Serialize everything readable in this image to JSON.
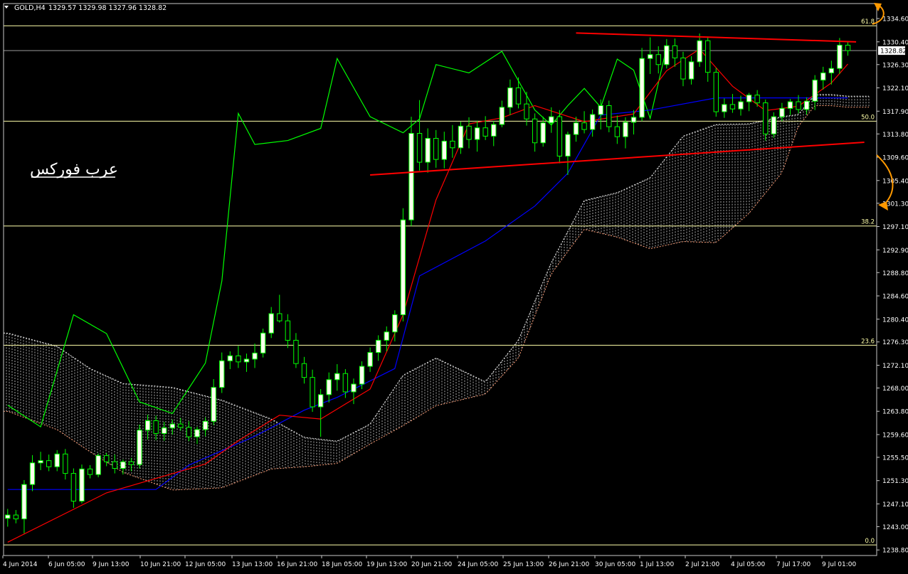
{
  "header": {
    "symbol_label": "GOLD,H4",
    "ohlc_text": "1329.57 1329.98 1327.96 1328.82"
  },
  "watermark": "عرب فوركس",
  "colors": {
    "background": "#000000",
    "axis": "#c8c8c8",
    "text": "#ffffff",
    "bull_candle": "#ffffee",
    "bear_candle": "#000000",
    "candle_line": "#00ff00",
    "tenkan": "#ff0000",
    "kijun": "#0000ff",
    "chikou": "#00ff00",
    "senkou_a": "#ffffff",
    "senkou_b": "#ffa07a",
    "fib": "#ffffaa",
    "trendline": "#ff0000",
    "annotation": "#ff9900"
  },
  "chart_data": {
    "type": "candlestick",
    "symbol": "GOLD",
    "timeframe": "H4",
    "last_price": 1328.82,
    "price_label": "1328.82",
    "ylim": [
      1237.8,
      1337.3
    ],
    "y_ticks": [
      "1334.60",
      "1330.40",
      "1326.30",
      "1322.10",
      "1317.90",
      "1313.80",
      "1309.60",
      "1305.40",
      "1301.30",
      "1297.10",
      "1292.90",
      "1288.80",
      "1284.60",
      "1280.40",
      "1276.30",
      "1272.10",
      "1268.00",
      "1263.80",
      "1259.60",
      "1255.50",
      "1251.30",
      "1247.10",
      "1243.00",
      "1238.80"
    ],
    "x_ticks": [
      "4 Jun 2014",
      "6 Jun 05:00",
      "9 Jun 13:00",
      "10 Jun 21:00",
      "12 Jun 05:00",
      "13 Jun 13:00",
      "16 Jun 21:00",
      "18 Jun 05:00",
      "19 Jun 13:00",
      "20 Jun 21:00",
      "24 Jun 05:00",
      "25 Jun 13:00",
      "26 Jun 21:00",
      "30 Jun 05:00",
      "1 Jul 13:00",
      "2 Jul 21:00",
      "4 Jul 05:00",
      "7 Jul 17:00",
      "9 Jul 01:00"
    ],
    "fibonacci": [
      {
        "label": "61.8",
        "price": 1333.3
      },
      {
        "label": "50.0",
        "price": 1316.1
      },
      {
        "label": "38.2",
        "price": 1297.2
      },
      {
        "label": "23.6",
        "price": 1275.7
      },
      {
        "label": "0.0",
        "price": 1239.7
      }
    ],
    "candles": [
      [
        1244.5,
        1246.2,
        1243.0,
        1245.1
      ],
      [
        1245.1,
        1246.0,
        1243.6,
        1244.4
      ],
      [
        1244.4,
        1251.4,
        1241.8,
        1250.6
      ],
      [
        1250.6,
        1255.9,
        1249.4,
        1254.5
      ],
      [
        1254.5,
        1256.5,
        1253.2,
        1254.9
      ],
      [
        1254.9,
        1256.0,
        1253.0,
        1253.8
      ],
      [
        1253.8,
        1256.8,
        1253.0,
        1256.1
      ],
      [
        1256.1,
        1257.0,
        1251.5,
        1252.6
      ],
      [
        1252.6,
        1253.5,
        1246.4,
        1247.6
      ],
      [
        1247.6,
        1254.2,
        1247.2,
        1253.4
      ],
      [
        1253.4,
        1254.1,
        1251.7,
        1252.4
      ],
      [
        1252.4,
        1256.2,
        1251.9,
        1255.8
      ],
      [
        1255.8,
        1256.3,
        1253.9,
        1254.7
      ],
      [
        1254.7,
        1256.0,
        1252.6,
        1253.5
      ],
      [
        1253.5,
        1255.1,
        1252.4,
        1254.7
      ],
      [
        1254.7,
        1255.4,
        1253.0,
        1254.2
      ],
      [
        1254.2,
        1261.4,
        1253.5,
        1260.4
      ],
      [
        1260.4,
        1263.2,
        1258.7,
        1262.1
      ],
      [
        1262.1,
        1263.0,
        1258.6,
        1259.8
      ],
      [
        1259.8,
        1261.9,
        1258.5,
        1260.8
      ],
      [
        1260.8,
        1262.3,
        1259.6,
        1261.5
      ],
      [
        1261.5,
        1262.6,
        1260.3,
        1260.9
      ],
      [
        1260.9,
        1262.0,
        1258.4,
        1259.2
      ],
      [
        1259.2,
        1261.0,
        1257.9,
        1260.5
      ],
      [
        1260.5,
        1262.7,
        1259.3,
        1262.0
      ],
      [
        1262.0,
        1269.6,
        1261.3,
        1268.1
      ],
      [
        1268.1,
        1274.4,
        1267.1,
        1272.9
      ],
      [
        1272.9,
        1274.6,
        1271.4,
        1273.8
      ],
      [
        1273.8,
        1275.6,
        1271.6,
        1272.7
      ],
      [
        1272.7,
        1274.2,
        1270.9,
        1273.2
      ],
      [
        1273.2,
        1276.0,
        1271.6,
        1274.3
      ],
      [
        1274.3,
        1278.7,
        1273.5,
        1277.9
      ],
      [
        1277.9,
        1282.6,
        1277.0,
        1281.4
      ],
      [
        1281.4,
        1284.8,
        1279.8,
        1280.1
      ],
      [
        1280.1,
        1281.3,
        1275.2,
        1276.6
      ],
      [
        1276.6,
        1277.9,
        1271.6,
        1272.4
      ],
      [
        1272.4,
        1273.6,
        1268.8,
        1269.9
      ],
      [
        1269.9,
        1271.3,
        1263.7,
        1264.6
      ],
      [
        1264.6,
        1267.8,
        1259.2,
        1266.8
      ],
      [
        1266.8,
        1270.8,
        1265.4,
        1269.5
      ],
      [
        1269.5,
        1272.3,
        1267.5,
        1270.6
      ],
      [
        1270.6,
        1271.4,
        1266.2,
        1267.3
      ],
      [
        1267.3,
        1269.7,
        1265.1,
        1268.7
      ],
      [
        1268.7,
        1272.8,
        1267.8,
        1271.9
      ],
      [
        1271.9,
        1275.3,
        1270.9,
        1274.4
      ],
      [
        1274.4,
        1277.5,
        1272.9,
        1276.6
      ],
      [
        1276.6,
        1279.1,
        1274.6,
        1278.1
      ],
      [
        1278.1,
        1282.0,
        1276.4,
        1281.2
      ],
      [
        1281.2,
        1300.4,
        1280.0,
        1298.3
      ],
      [
        1298.3,
        1316.9,
        1297.2,
        1313.9
      ],
      [
        1313.9,
        1319.9,
        1307.2,
        1308.7
      ],
      [
        1308.7,
        1314.8,
        1306.8,
        1313.0
      ],
      [
        1313.0,
        1314.5,
        1307.7,
        1309.2
      ],
      [
        1309.2,
        1314.2,
        1307.6,
        1312.5
      ],
      [
        1312.5,
        1315.4,
        1309.5,
        1311.3
      ],
      [
        1311.3,
        1316.0,
        1310.2,
        1315.2
      ],
      [
        1315.2,
        1316.8,
        1311.2,
        1312.8
      ],
      [
        1312.8,
        1316.2,
        1310.6,
        1314.9
      ],
      [
        1314.9,
        1317.0,
        1312.7,
        1313.4
      ],
      [
        1313.4,
        1316.1,
        1311.6,
        1315.5
      ],
      [
        1315.5,
        1319.8,
        1315.0,
        1318.6
      ],
      [
        1318.6,
        1323.6,
        1317.2,
        1322.1
      ],
      [
        1322.1,
        1324.0,
        1318.4,
        1319.2
      ],
      [
        1319.2,
        1321.4,
        1315.3,
        1316.5
      ],
      [
        1316.5,
        1317.5,
        1310.6,
        1312.2
      ],
      [
        1312.2,
        1316.9,
        1311.5,
        1315.8
      ],
      [
        1315.8,
        1318.6,
        1314.0,
        1316.9
      ],
      [
        1316.9,
        1318.1,
        1308.5,
        1309.8
      ],
      [
        1309.8,
        1314.2,
        1306.4,
        1313.7
      ],
      [
        1313.7,
        1316.9,
        1312.4,
        1315.8
      ],
      [
        1315.8,
        1317.9,
        1313.9,
        1314.6
      ],
      [
        1314.6,
        1318.2,
        1313.3,
        1317.3
      ],
      [
        1317.3,
        1320.0,
        1314.6,
        1318.9
      ],
      [
        1318.9,
        1319.8,
        1314.1,
        1315.1
      ],
      [
        1315.1,
        1317.1,
        1312.0,
        1313.3
      ],
      [
        1313.3,
        1316.8,
        1311.2,
        1315.9
      ],
      [
        1315.9,
        1318.1,
        1313.7,
        1316.8
      ],
      [
        1316.8,
        1329.3,
        1316.1,
        1327.4
      ],
      [
        1327.4,
        1331.2,
        1324.6,
        1328.1
      ],
      [
        1328.1,
        1329.6,
        1324.7,
        1326.3
      ],
      [
        1326.3,
        1330.9,
        1325.6,
        1329.7
      ],
      [
        1329.7,
        1331.0,
        1325.9,
        1327.5
      ],
      [
        1327.5,
        1328.6,
        1322.4,
        1323.7
      ],
      [
        1323.7,
        1327.8,
        1322.7,
        1326.8
      ],
      [
        1326.8,
        1331.9,
        1325.9,
        1330.6
      ],
      [
        1330.6,
        1331.2,
        1323.2,
        1324.9
      ],
      [
        1324.9,
        1325.7,
        1316.9,
        1317.8
      ],
      [
        1317.8,
        1320.2,
        1316.7,
        1319.1
      ],
      [
        1319.1,
        1321.0,
        1317.6,
        1318.3
      ],
      [
        1318.3,
        1320.7,
        1317.1,
        1319.6
      ],
      [
        1319.6,
        1321.2,
        1317.9,
        1320.8
      ],
      [
        1320.8,
        1321.7,
        1318.7,
        1319.4
      ],
      [
        1319.4,
        1320.0,
        1312.6,
        1313.8
      ],
      [
        1313.8,
        1317.7,
        1313.1,
        1316.9
      ],
      [
        1316.9,
        1319.4,
        1316.1,
        1318.4
      ],
      [
        1318.4,
        1320.1,
        1317.2,
        1319.6
      ],
      [
        1319.6,
        1320.8,
        1317.5,
        1318.2
      ],
      [
        1318.2,
        1320.4,
        1317.3,
        1319.7
      ],
      [
        1319.7,
        1324.4,
        1318.1,
        1323.5
      ],
      [
        1323.5,
        1325.9,
        1321.8,
        1324.8
      ],
      [
        1324.8,
        1327.0,
        1322.7,
        1325.6
      ],
      [
        1325.6,
        1331.1,
        1324.6,
        1329.8
      ],
      [
        1329.8,
        1330.4,
        1327.9,
        1328.82
      ]
    ],
    "tenkan_sen": [
      [
        0,
        1240.2
      ],
      [
        12,
        1249.1
      ],
      [
        24,
        1254.3
      ],
      [
        28,
        1258.5
      ],
      [
        33,
        1263.1
      ],
      [
        38,
        1262.4
      ],
      [
        44,
        1267.8
      ],
      [
        48,
        1281.2
      ],
      [
        52,
        1301.9
      ],
      [
        56,
        1315.6
      ],
      [
        60,
        1316.7
      ],
      [
        64,
        1318.9
      ],
      [
        70,
        1316.0
      ],
      [
        76,
        1317.4
      ],
      [
        80,
        1325.2
      ],
      [
        84,
        1329.1
      ],
      [
        88,
        1322.4
      ],
      [
        92,
        1318.0
      ],
      [
        96,
        1318.8
      ],
      [
        100,
        1323.0
      ],
      [
        102,
        1326.4
      ]
    ],
    "kijun_sen": [
      [
        0,
        1249.7
      ],
      [
        18,
        1249.7
      ],
      [
        22,
        1254.1
      ],
      [
        30,
        1259.3
      ],
      [
        36,
        1264.0
      ],
      [
        40,
        1266.3
      ],
      [
        47,
        1271.5
      ],
      [
        50,
        1288.2
      ],
      [
        58,
        1294.5
      ],
      [
        64,
        1300.8
      ],
      [
        68,
        1306.7
      ],
      [
        72,
        1317.2
      ],
      [
        78,
        1318.1
      ],
      [
        86,
        1320.3
      ],
      [
        102,
        1320.3
      ]
    ],
    "chikou_span": [
      [
        0,
        1264.9
      ],
      [
        4,
        1261.0
      ],
      [
        8,
        1281.2
      ],
      [
        12,
        1277.8
      ],
      [
        16,
        1265.5
      ],
      [
        20,
        1263.4
      ],
      [
        24,
        1272.5
      ],
      [
        26,
        1287.3
      ],
      [
        28,
        1317.5
      ],
      [
        30,
        1311.9
      ],
      [
        34,
        1312.6
      ],
      [
        38,
        1314.8
      ],
      [
        40,
        1327.4
      ],
      [
        44,
        1316.9
      ],
      [
        48,
        1314.0
      ],
      [
        50,
        1316.5
      ],
      [
        52,
        1326.3
      ],
      [
        56,
        1324.8
      ],
      [
        60,
        1328.7
      ],
      [
        64,
        1318.1
      ],
      [
        66,
        1315.4
      ],
      [
        68,
        1318.9
      ],
      [
        70,
        1322.0
      ],
      [
        72,
        1318.6
      ],
      [
        74,
        1327.3
      ],
      [
        76,
        1325.3
      ],
      [
        78,
        1316.6
      ],
      [
        80,
        1329.4
      ]
    ],
    "kumo": [
      [
        0,
        1277.9,
        1263.8
      ],
      [
        6,
        1275.5,
        1260.5
      ],
      [
        10,
        1271.5,
        1256.5
      ],
      [
        14,
        1268.8,
        1252.8
      ],
      [
        20,
        1268.1,
        1249.6
      ],
      [
        26,
        1265.8,
        1250.0
      ],
      [
        32,
        1262.4,
        1253.4
      ],
      [
        36,
        1259.1,
        1253.8
      ],
      [
        40,
        1258.4,
        1254.4
      ],
      [
        44,
        1261.5,
        1257.9
      ],
      [
        48,
        1270.3,
        1261.2
      ],
      [
        52,
        1273.4,
        1264.8
      ],
      [
        58,
        1269.1,
        1266.9
      ],
      [
        62,
        1276.6,
        1273.4
      ],
      [
        66,
        1290.6,
        1288.6
      ],
      [
        70,
        1301.8,
        1296.6
      ],
      [
        74,
        1303.2,
        1295.2
      ],
      [
        78,
        1305.9,
        1293.1
      ],
      [
        82,
        1313.4,
        1294.4
      ],
      [
        86,
        1315.5,
        1294.2
      ],
      [
        90,
        1315.6,
        1299.5
      ],
      [
        94,
        1316.9,
        1306.8
      ],
      [
        96,
        1317.3,
        1315.2
      ],
      [
        98,
        1320.9,
        1318.9
      ],
      [
        100,
        1320.9,
        1318.9
      ],
      [
        102,
        1320.6,
        1318.6
      ]
    ],
    "trendlines": [
      {
        "from": [
          69,
          1332.0
        ],
        "to": [
          103,
          1330.4
        ]
      },
      {
        "from": [
          44,
          1306.4
        ],
        "to": [
          104,
          1312.3
        ]
      }
    ]
  }
}
